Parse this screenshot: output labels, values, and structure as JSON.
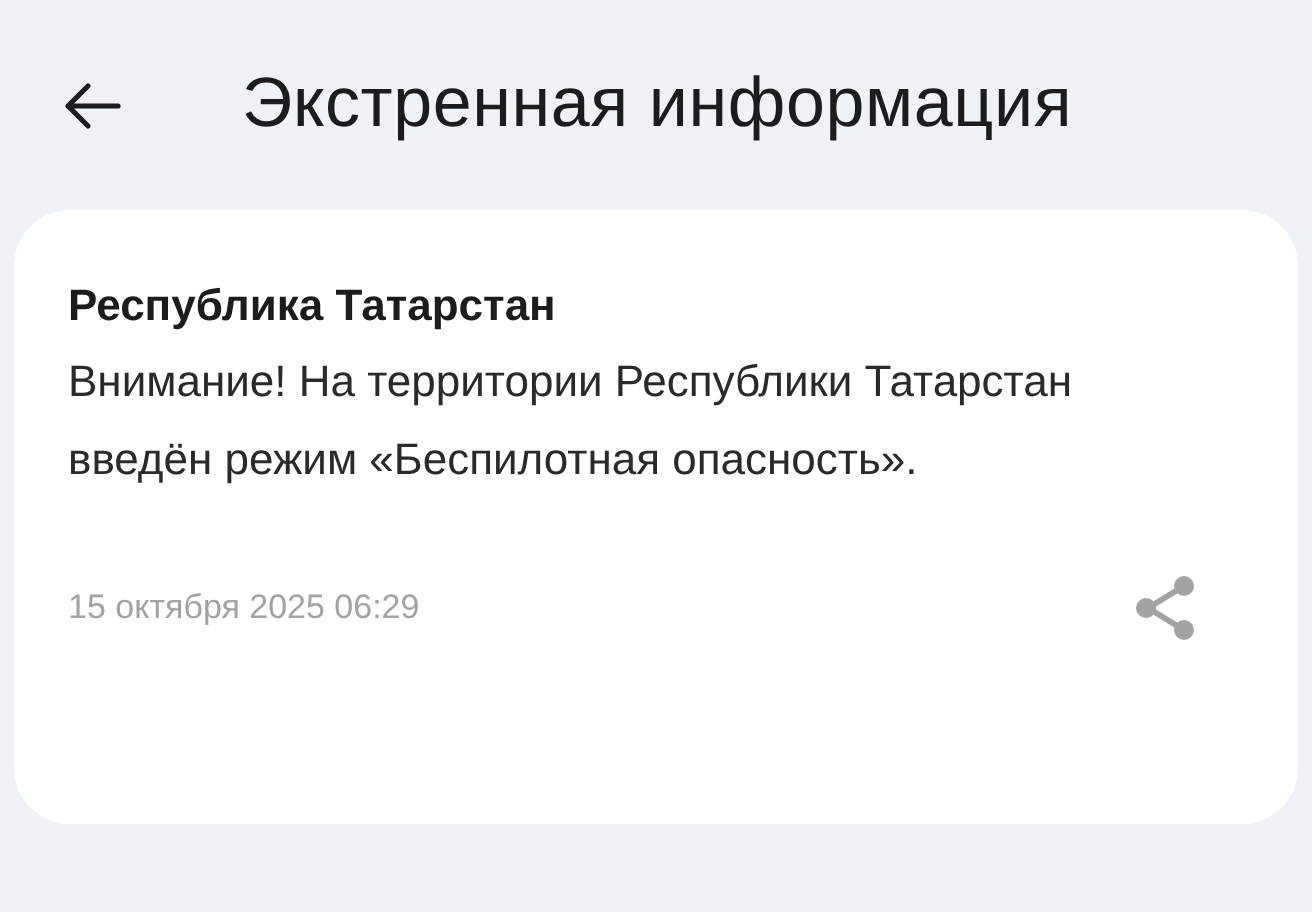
{
  "header": {
    "title": "Экстренная информация"
  },
  "alert": {
    "region": "Республика Татарстан",
    "message": "Внимание! На территории Республики Татарстан введён режим «Беспилотная опасность».",
    "date": "15 октября 2025 06:29"
  }
}
